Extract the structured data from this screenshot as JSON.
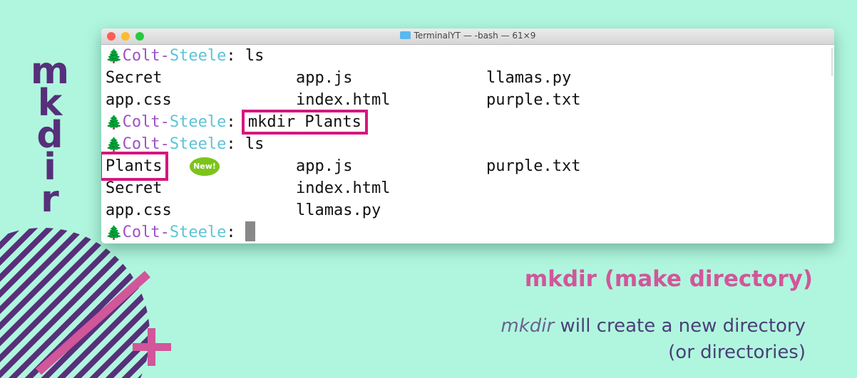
{
  "slide": {
    "vertical_title": [
      "m",
      "k",
      "d",
      "i",
      "r"
    ],
    "heading": "mkdir (make directory)",
    "desc_cmd": "mkdir",
    "desc_rest": " will create a new directory",
    "desc_line2": "(or directories)"
  },
  "window": {
    "title": "TerminalYT — -bash — 61×9",
    "prompt": {
      "icon": "pine-tree-icon",
      "tree": "🌲",
      "user": "Colt-",
      "host": "Steele",
      "sep": ": "
    },
    "lines": [
      {
        "cmd": "ls"
      },
      {
        "cols": [
          "Secret",
          "app.js",
          "llamas.py"
        ]
      },
      {
        "cols": [
          "app.css",
          "index.html",
          "purple.txt"
        ]
      },
      {
        "cmd": "mkdir Plants",
        "highlight": true
      },
      {
        "cmd": "ls"
      },
      {
        "cols": [
          "Plants",
          "app.js",
          "purple.txt"
        ],
        "highlight_first": true,
        "badge": "New!"
      },
      {
        "cols": [
          "Secret",
          "index.html",
          ""
        ]
      },
      {
        "cols": [
          "app.css",
          "llamas.py",
          ""
        ]
      },
      {
        "cmd": ""
      }
    ]
  },
  "colors": {
    "background": "#b0f6de",
    "accent_purple": "#56307a",
    "accent_pink": "#d1569a",
    "highlight": "#d6167f"
  }
}
